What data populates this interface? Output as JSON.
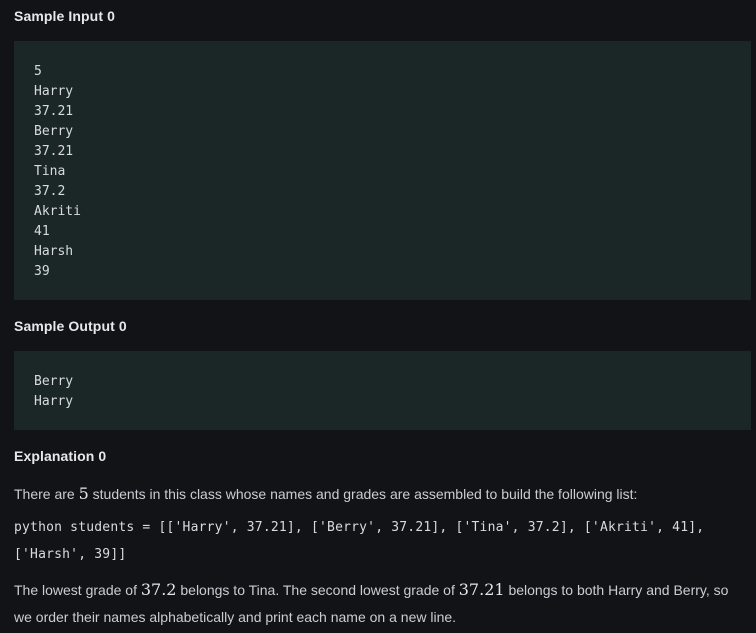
{
  "sample_input": {
    "title": "Sample Input 0",
    "lines": [
      "5",
      "Harry",
      "37.21",
      "Berry",
      "37.21",
      "Tina",
      "37.2",
      "Akriti",
      "41",
      "Harsh",
      "39"
    ]
  },
  "sample_output": {
    "title": "Sample Output 0",
    "lines": [
      "Berry",
      "Harry"
    ]
  },
  "explanation": {
    "title": "Explanation 0",
    "p1_pre": "There are ",
    "p1_math": "5",
    "p1_post": " students in this class whose names and grades are assembled to build the following list:",
    "code_line1": "python students = [['Harry', 37.21], ['Berry', 37.21], ['Tina', 37.2], ['Akriti', 41],",
    "code_line2": "['Harsh', 39]]",
    "p2_a": "The lowest grade of ",
    "p2_math1": "37.2",
    "p2_b": " belongs to Tina. The second lowest grade of ",
    "p2_math2": "37.21",
    "p2_c": " belongs to both Harry and Berry, so",
    "p3": "we order their names alphabetically and print each name on a new line."
  }
}
